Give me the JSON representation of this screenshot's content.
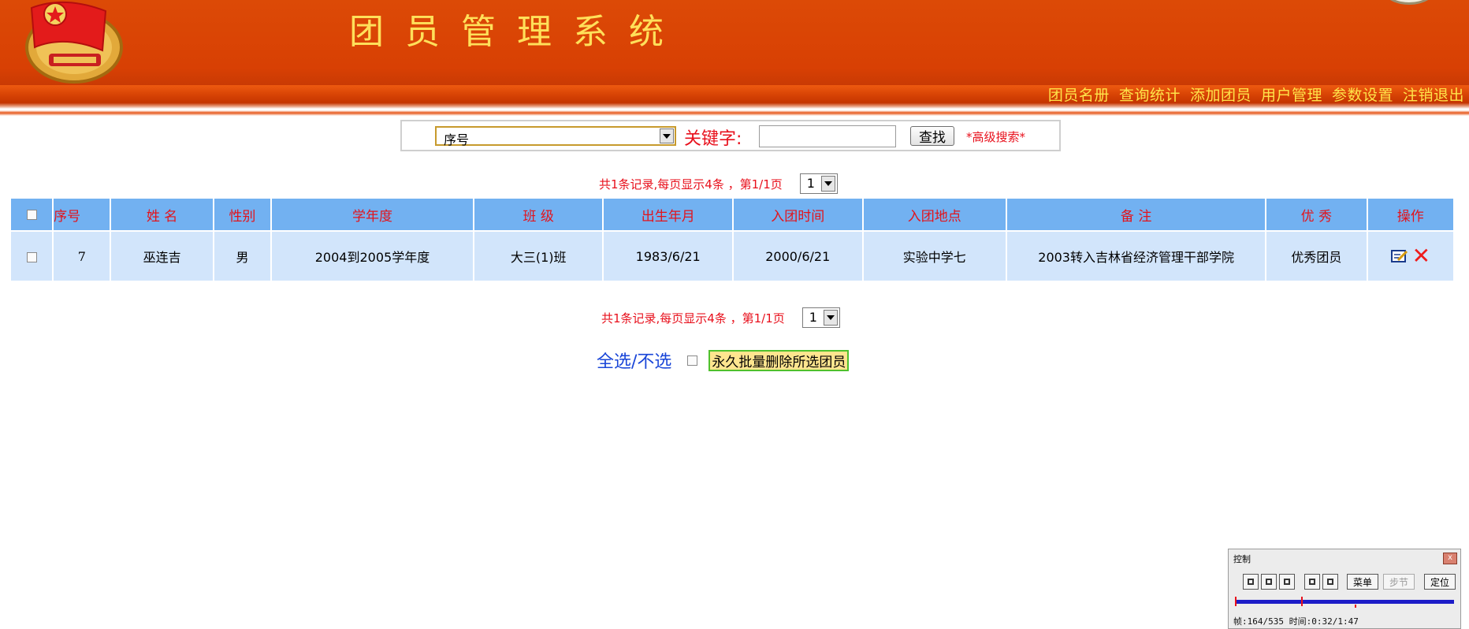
{
  "header": {
    "title": "团员管理系统",
    "nav": [
      "团员名册",
      "查询统计",
      "添加团员",
      "用户管理",
      "参数设置",
      "注销退出"
    ]
  },
  "search": {
    "field_selected": "序号",
    "keyword_label": "关键字:",
    "keyword_value": "",
    "find_label": "查找",
    "advanced_label": "*高级搜索*"
  },
  "pager": {
    "text": "共1条记录,每页显示4条 ，第1/1页",
    "page": "1"
  },
  "table": {
    "headers": [
      "序号",
      "姓 名",
      "性别",
      "学年度",
      "班 级",
      "出生年月",
      "入团时间",
      "入团地点",
      "备 注",
      "优 秀",
      "操作"
    ],
    "rows": [
      [
        "7",
        "巫连吉",
        "男",
        "2004到2005学年度",
        "大三(1)班",
        "1983/6/21",
        "2000/6/21",
        "实验中学七",
        "2003转入吉林省经济管理干部学院",
        "优秀团员"
      ]
    ]
  },
  "bulk": {
    "select_all_label": "全选/不选",
    "delete_label": "永久批量删除所选团员"
  },
  "control_panel": {
    "title": "控制",
    "close": "x",
    "menu_label": "菜单",
    "step_label": "步节",
    "locate_label": "定位",
    "status": "帧:164/535 时间:0:32/1:47"
  },
  "colors": {
    "header_bg": "#d84004",
    "title": "#ffe05a",
    "nav_text": "#ffe44a",
    "table_header_bg": "#72b1f1",
    "table_row_bg": "#d2e5fb",
    "accent_red": "#e8101c"
  }
}
